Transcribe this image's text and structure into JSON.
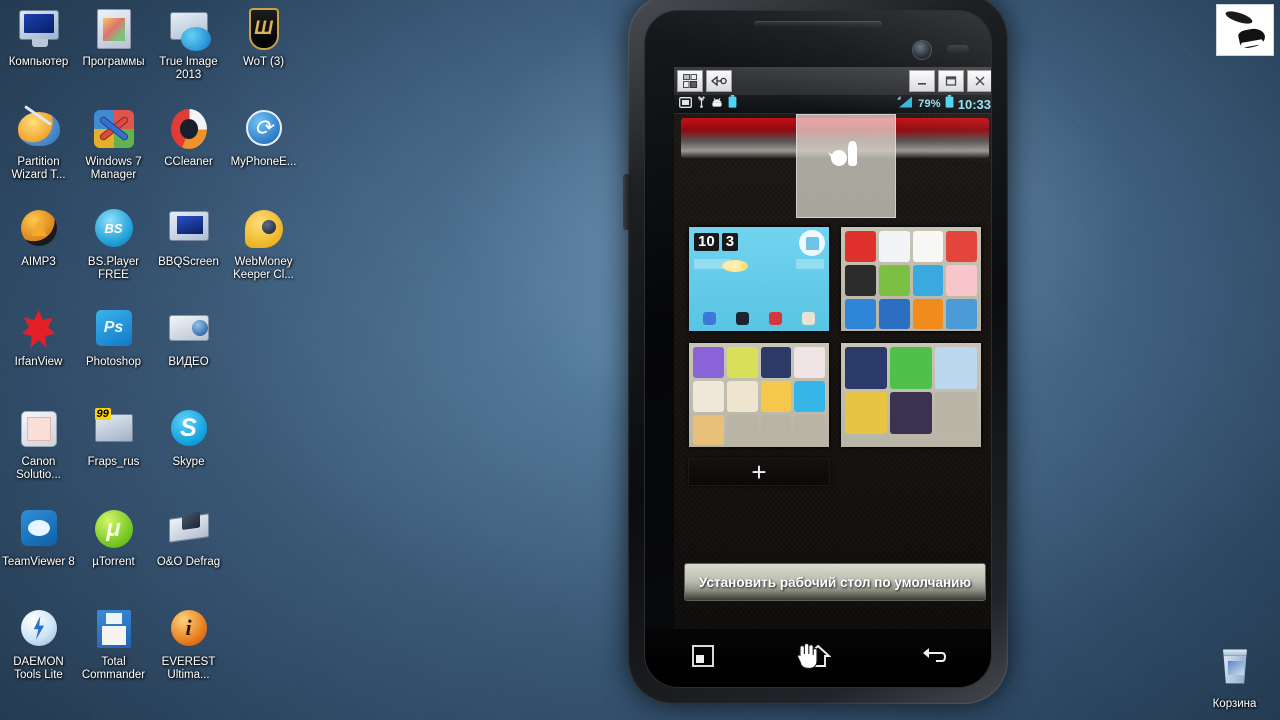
{
  "desktop": {
    "icons": [
      {
        "label": "Компьютер",
        "art": "art-monitor",
        "name": "desktop-icon-computer"
      },
      {
        "label": "Программы",
        "art": "art-folderbox",
        "name": "desktop-icon-programs"
      },
      {
        "label": "True Image 2013",
        "art": "art-trueimg",
        "name": "desktop-icon-true-image-2013"
      },
      {
        "label": "WoT (3)",
        "art": "art-wot",
        "name": "desktop-icon-wot"
      },
      {
        "label": "Partition Wizard T...",
        "art": "art-partition",
        "name": "desktop-icon-partition-wizard"
      },
      {
        "label": "Windows 7 Manager",
        "art": "art-win7m",
        "name": "desktop-icon-windows-7-manager"
      },
      {
        "label": "CCleaner",
        "art": "art-ccleaner",
        "name": "desktop-icon-ccleaner"
      },
      {
        "label": "MyPhoneE...",
        "art": "art-myphone",
        "name": "desktop-icon-myphoneexplorer"
      },
      {
        "label": "AIMP3",
        "art": "art-aimp",
        "name": "desktop-icon-aimp3"
      },
      {
        "label": "BS.Player FREE",
        "art": "art-bsplayer",
        "name": "desktop-icon-bsplayer-free"
      },
      {
        "label": "BBQScreen",
        "art": "art-bbq",
        "name": "desktop-icon-bbqscreen"
      },
      {
        "label": "WebMoney Keeper Cl...",
        "art": "art-webmoney",
        "name": "desktop-icon-webmoney-keeper"
      },
      {
        "label": "IrfanView",
        "art": "art-irfan",
        "name": "desktop-icon-irfanview"
      },
      {
        "label": "Photoshop",
        "art": "art-ps",
        "name": "desktop-icon-photoshop"
      },
      {
        "label": "ВИДЕО",
        "art": "art-video",
        "name": "desktop-icon-video"
      },
      {
        "label": "",
        "art": "",
        "name": "desktop-icon-empty-1"
      },
      {
        "label": "Canon Solutio...",
        "art": "art-canon",
        "name": "desktop-icon-canon-solution"
      },
      {
        "label": "Fraps_rus",
        "art": "art-fraps",
        "name": "desktop-icon-fraps-rus"
      },
      {
        "label": "Skype",
        "art": "art-skype",
        "name": "desktop-icon-skype"
      },
      {
        "label": "",
        "art": "",
        "name": "desktop-icon-empty-2"
      },
      {
        "label": "TeamViewer 8",
        "art": "art-teamviewer",
        "name": "desktop-icon-teamviewer-8"
      },
      {
        "label": "µTorrent",
        "art": "art-utorrent",
        "name": "desktop-icon-utorrent"
      },
      {
        "label": "O&O Defrag",
        "art": "art-oo",
        "name": "desktop-icon-oo-defrag"
      },
      {
        "label": "",
        "art": "",
        "name": "desktop-icon-empty-3"
      },
      {
        "label": "DAEMON Tools Lite",
        "art": "art-daemon",
        "name": "desktop-icon-daemon-tools-lite"
      },
      {
        "label": "Total Commander",
        "art": "art-tc",
        "name": "desktop-icon-total-commander"
      },
      {
        "label": "EVEREST Ultima...",
        "art": "art-everest",
        "name": "desktop-icon-everest-ultimate"
      },
      {
        "label": "",
        "art": "",
        "name": "desktop-icon-empty-4"
      }
    ],
    "recycle_bin": {
      "label": "Корзина"
    }
  },
  "window": {
    "toolbar": {
      "layout_button": "layout-icon",
      "connect_button": "connect-icon"
    },
    "controls": {
      "minimize": "minimize-icon",
      "maximize": "maximize-icon",
      "close": "close-icon"
    }
  },
  "statusbar": {
    "icons": [
      "screenshot-icon",
      "usb-icon",
      "android-icon",
      "battery-icon"
    ],
    "signal": "signal-icon",
    "battery_percent": "79%",
    "time": "10:33"
  },
  "launcher": {
    "delete_bar_label": "",
    "drop_zone_icon": "trash-icon",
    "previews": [
      {
        "name": "homescreen-preview-1",
        "type": "clock",
        "clock_hour": "10",
        "clock_minute": "3",
        "dock_colors": [
          "#3b79d8",
          "#1b2530",
          "#d8353c",
          "#e8e3d4"
        ]
      },
      {
        "name": "homescreen-preview-2",
        "type": "apps",
        "cols": 4,
        "icon_colors": [
          "#e0322c",
          "#f2f4f6",
          "#f7f8f6",
          "#e3453c",
          "#2b2b2b",
          "#7bc043",
          "#39a9e0",
          "#f6c6cb",
          "#2f86d8",
          "#2a6fc0",
          "#f08c1e",
          "#4a9ad8",
          "#f0a8b4",
          "#2f6fb8",
          "#c86a30",
          "#b8b5a6"
        ]
      },
      {
        "name": "homescreen-preview-3",
        "type": "apps",
        "cols": 4,
        "icon_colors": [
          "#8a63d8",
          "#d8e05a",
          "#2b3a66",
          "#f0e4e6",
          "#efe8da",
          "#efe5cf",
          "#f5c84c",
          "#36b6e8",
          "#e8c07a",
          "#b8b5a6",
          "#b8b5a6",
          "#b8b5a6"
        ]
      },
      {
        "name": "homescreen-preview-4",
        "type": "apps",
        "cols": 3,
        "icon_colors": [
          "#2a3a6a",
          "#4fc04a",
          "#bcd8ee",
          "#e8c444",
          "#3a3250",
          "#b8b5a6"
        ]
      },
      {
        "name": "homescreen-preview-add",
        "type": "add",
        "plus": "+"
      }
    ],
    "default_button": "Установить рабочий стол по умолчанию"
  },
  "navbar": {
    "recent": "recent-apps-icon",
    "home": "home-icon",
    "back": "back-icon"
  }
}
